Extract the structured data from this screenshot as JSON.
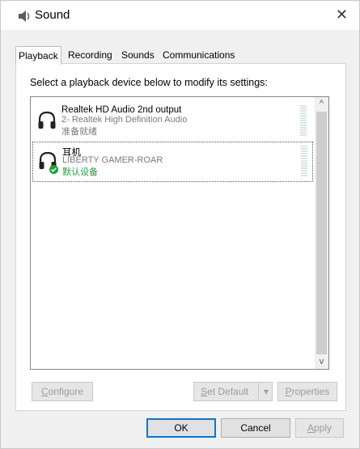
{
  "window": {
    "title": "Sound",
    "close_glyph": "✕",
    "icon": "speaker-icon"
  },
  "tabs": [
    {
      "label": "Playback",
      "active": true
    },
    {
      "label": "Recording",
      "active": false
    },
    {
      "label": "Sounds",
      "active": false
    },
    {
      "label": "Communications",
      "active": false
    }
  ],
  "instruction": "Select a playback device below to modify its settings:",
  "devices": [
    {
      "name": "Realtek HD Audio 2nd output",
      "description": "2- Realtek High Definition Audio",
      "status": "准备就绪",
      "icon": "headphones-icon",
      "default": false,
      "selected": false
    },
    {
      "name": "耳机",
      "description": "LIBERTY GAMER-ROAR",
      "status": "默认设备",
      "icon": "headphones-icon",
      "default": true,
      "selected": true
    }
  ],
  "scrollbar": {
    "up_glyph": "^",
    "down_glyph": "v"
  },
  "buttons": {
    "configure": {
      "prefix": "",
      "accel": "C",
      "rest": "onfigure",
      "enabled": false
    },
    "set_default": {
      "prefix": "",
      "accel": "S",
      "rest": "et Default",
      "enabled": false
    },
    "set_default_arrow": "▾",
    "properties": {
      "prefix": "",
      "accel": "P",
      "rest": "roperties",
      "enabled": false
    },
    "ok": {
      "label": "OK",
      "enabled": true
    },
    "cancel": {
      "label": "Cancel",
      "enabled": true
    },
    "apply": {
      "prefix": "",
      "accel": "A",
      "rest": "pply",
      "enabled": false
    }
  },
  "colors": {
    "default_badge": "#1f9e3a",
    "focus_border": "#0078d7",
    "level_meter": "#d7e8dc"
  }
}
